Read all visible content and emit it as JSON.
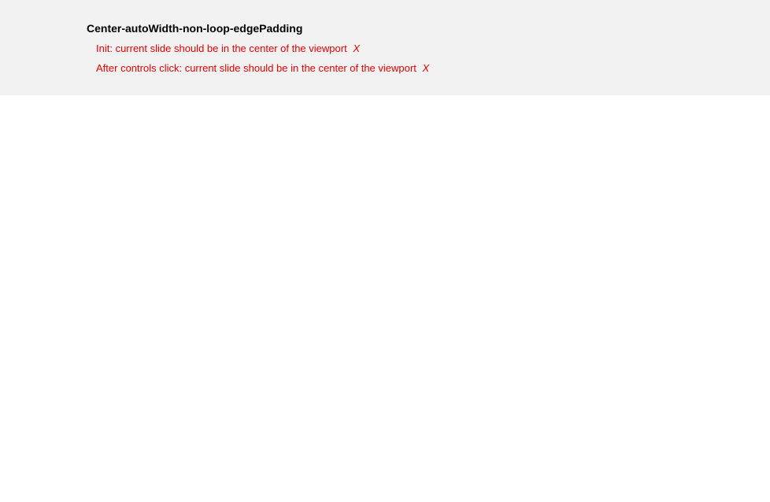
{
  "section": {
    "title": "Center-autoWidth-non-loop-edgePadding",
    "tests": [
      {
        "text": "Init: current slide should be in the center of the viewport",
        "mark": "X"
      },
      {
        "text": "After controls click: current slide should be in the center of the viewport",
        "mark": "X"
      }
    ]
  }
}
